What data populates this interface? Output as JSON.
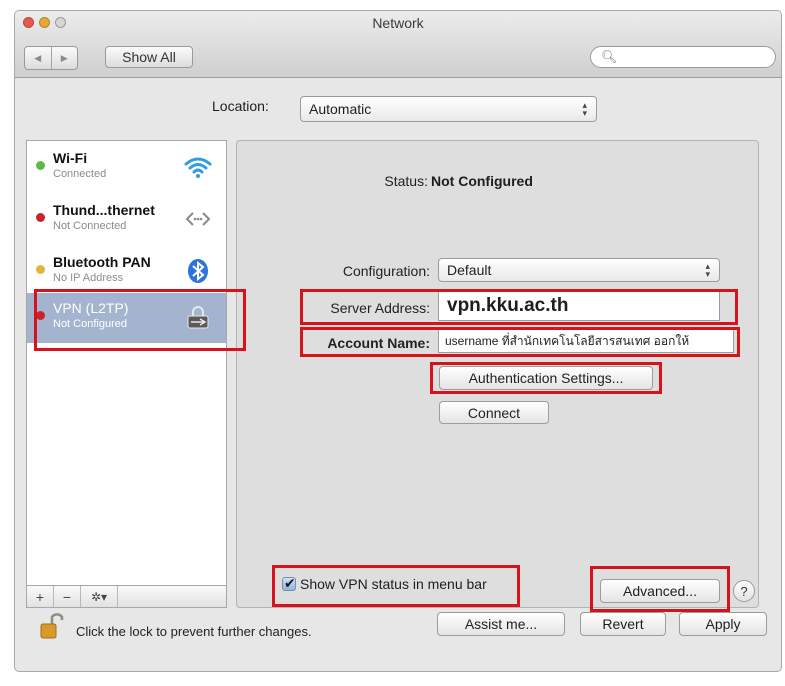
{
  "window": {
    "title": "Network"
  },
  "toolbar": {
    "back": "◀",
    "forward": "▶",
    "show_all": "Show All",
    "search_placeholder": ""
  },
  "location": {
    "label": "Location:",
    "value": "Automatic"
  },
  "services": [
    {
      "name": "Wi-Fi",
      "status": "Connected",
      "dot": "#5fb84a",
      "icon": "wifi-icon"
    },
    {
      "name": "Thund...thernet",
      "status": "Not Connected",
      "dot": "#c8242b",
      "icon": "ethernet-arrows-icon"
    },
    {
      "name": "Bluetooth PAN",
      "status": "No IP Address",
      "dot": "#e0b63a",
      "icon": "bluetooth-icon"
    },
    {
      "name": "VPN (L2TP)",
      "status": "Not Configured",
      "dot": "#c8242b",
      "icon": "vpn-lock-icon"
    }
  ],
  "sidebar_toolbar": {
    "add": "+",
    "remove": "−",
    "gear": "✲▾"
  },
  "detail": {
    "status_label": "Status:",
    "status_value": "Not Configured",
    "configuration_label": "Configuration:",
    "configuration_value": "Default",
    "server_label": "Server Address:",
    "server_value": "vpn.kku.ac.th",
    "account_label": "Account Name:",
    "account_value": "username  ที่สำนักเทคโนโลยีสารสนเทศ ออกให้",
    "auth_button": "Authentication Settings...",
    "connect_button": "Connect",
    "show_vpn_status": "Show VPN status in menu bar",
    "advanced_button": "Advanced...",
    "help": "?"
  },
  "footer": {
    "lock_text": "Click the lock to prevent further changes.",
    "assist": "Assist me...",
    "revert": "Revert",
    "apply": "Apply"
  },
  "colors": {
    "highlight_red": "#d8121b",
    "selection": "#a4b4cf"
  }
}
